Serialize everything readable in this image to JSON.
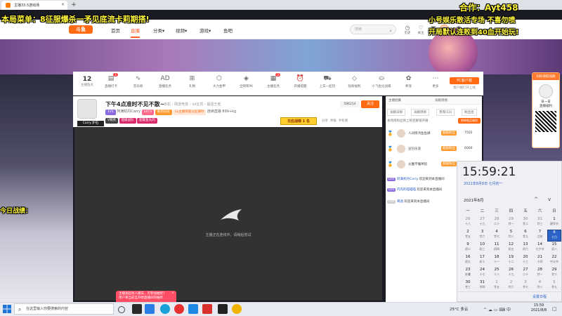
{
  "browser": {
    "tab_title": "主播33.5游戏场",
    "new_tab": "+"
  },
  "site": {
    "logo": "斗鱼",
    "nav": [
      "首页",
      "直播",
      "分类",
      "视频",
      "游戏",
      "鱼吧"
    ],
    "nav_arrows": [
      "▾",
      "▾",
      "▾"
    ],
    "search_placeholder": "搜索",
    "header_icons": [
      {
        "icon": "clock-icon",
        "label": "历史"
      },
      {
        "icon": "follow-icon",
        "label": "关注"
      },
      {
        "icon": "video-icon",
        "label": "视频"
      },
      {
        "icon": "broadcast-icon",
        "label": "开播"
      }
    ]
  },
  "toolbar": {
    "count": "12",
    "count_label": "主播鱼丸",
    "items": [
      {
        "icon": "bag-icon",
        "label": "直播打卡",
        "badge": "1"
      },
      {
        "icon": "waveform-icon",
        "label": "音乐榜"
      },
      {
        "icon": "ad-icon",
        "label": "直播任务"
      },
      {
        "icon": "gift-icon",
        "label": "礼物"
      },
      {
        "icon": "shield-icon",
        "label": "大力金甲"
      },
      {
        "icon": "shield2-icon",
        "label": "全网荣PK"
      },
      {
        "icon": "task-icon",
        "label": "主播任务",
        "badge": "2"
      },
      {
        "icon": "alarm-icon",
        "label": "开播提醒"
      },
      {
        "icon": "car-icon",
        "label": "上车一起玩"
      },
      {
        "icon": "diamond-icon",
        "label": "钻粉福利"
      },
      {
        "icon": "game-icon",
        "label": "小飞鱼论战棋"
      },
      {
        "icon": "pet-icon",
        "label": "养宠"
      },
      {
        "icon": "more-icon",
        "label": "更多"
      }
    ],
    "pc_button": "PC客户端",
    "pc_sub": "客户端打开上线"
  },
  "stream": {
    "title": "下午4点准时不见不散~",
    "category": "单机 › 网游竞技 › lol云顶 › 最强王者",
    "streamer_tag": "Carry 炉石",
    "meta": [
      "1V1",
      "阿满机丹Carry",
      "1473",
      "黄玥日玩",
      "LL主播荣誉认证满时",
      "连续直播",
      "899+kg"
    ],
    "viewers": "586214",
    "follow": "关注",
    "tags": [
      "V精英",
      "超级战队",
      "超能鱼丸的"
    ],
    "rank_btn": "日应战榜 1 名",
    "actions": [
      "分享",
      "举报",
      "手机看"
    ],
    "offline_text": "主播正在连线中，请稍后尝试",
    "toast": [
      "主播发起杀人跟车，可参加抽奖?",
      "用户将当前互开始直播间的抽奖"
    ],
    "toast_close": "×"
  },
  "right_panel": {
    "tabs": [
      "主播招募",
      "贡献周榜"
    ],
    "tabs2": [
      "贡献日榜",
      "贡献周榜",
      "贵宾(53)",
      "粉丝团"
    ],
    "note": "本场周粉丝榜上榜且解锁开播",
    "note_btn": "榜单购买福利",
    "ranks": [
      {
        "medal": "🏅",
        "name": "人间惊鸿鱼鱼肆",
        "level": "超级粉丝",
        "score": "7502"
      },
      {
        "medal": "🏅",
        "name": "豆包乐浪",
        "level": "超级粉丝",
        "score": "6000"
      },
      {
        "medal": "🏅",
        "name": "炎魔不懂神韵",
        "level": "超级粉丝",
        "score": "4"
      }
    ],
    "chats": [
      {
        "tag": "LV4",
        "name": "阿满机丹Carry",
        "text": "欢迎来到本直播间"
      },
      {
        "tag": "LV4",
        "name": "内内的喵喵喵",
        "text": "欢迎来到本直播间"
      },
      {
        "tag": "LV4",
        "name": "喝酒",
        "text": "欢迎来到本直播间"
      }
    ]
  },
  "overlays": {
    "top_left": "本局菜单：8征服爆杀一矛见底流卡莉期搭!",
    "top_right": "合作：Ayt458",
    "right_2": "小号娱乐散活专场 不喜勿喷",
    "right_3": "开局默认连败到40血开始玩!",
    "left_mid": "今日战绩："
  },
  "qr_card": {
    "header": "扫码领取加群",
    "name": "日一日",
    "sub": "直播福利"
  },
  "calendar": {
    "time": "15:59:21",
    "date_line": "2021年8月8日 七月初一",
    "month": "2021年8月",
    "nav_up": "^",
    "nav_down": "v",
    "weekdays": [
      "一",
      "二",
      "三",
      "四",
      "五",
      "六",
      "日"
    ],
    "days": [
      {
        "d": "26",
        "s": "十八",
        "dim": true
      },
      {
        "d": "27",
        "s": "十九",
        "dim": true
      },
      {
        "d": "28",
        "s": "二十",
        "dim": true
      },
      {
        "d": "29",
        "s": "廿一",
        "dim": true
      },
      {
        "d": "30",
        "s": "廿二",
        "dim": true
      },
      {
        "d": "31",
        "s": "廿三",
        "dim": true
      },
      {
        "d": "1",
        "s": "建军节"
      },
      {
        "d": "2",
        "s": "廿五"
      },
      {
        "d": "3",
        "s": "廿六"
      },
      {
        "d": "4",
        "s": "廿七"
      },
      {
        "d": "5",
        "s": "廿八"
      },
      {
        "d": "6",
        "s": "廿九"
      },
      {
        "d": "7",
        "s": "立秋"
      },
      {
        "d": "8",
        "s": "七月",
        "today": true
      },
      {
        "d": "9",
        "s": "初二"
      },
      {
        "d": "10",
        "s": "初三"
      },
      {
        "d": "11",
        "s": "初四"
      },
      {
        "d": "12",
        "s": "初五"
      },
      {
        "d": "13",
        "s": "初六"
      },
      {
        "d": "14",
        "s": "七夕节"
      },
      {
        "d": "15",
        "s": "初八"
      },
      {
        "d": "16",
        "s": "初九"
      },
      {
        "d": "17",
        "s": "初十"
      },
      {
        "d": "18",
        "s": "十一"
      },
      {
        "d": "19",
        "s": "十二"
      },
      {
        "d": "20",
        "s": "十三"
      },
      {
        "d": "21",
        "s": "十四"
      },
      {
        "d": "22",
        "s": "中元节"
      },
      {
        "d": "23",
        "s": "处暑"
      },
      {
        "d": "24",
        "s": "十七"
      },
      {
        "d": "25",
        "s": "十八"
      },
      {
        "d": "26",
        "s": "十九"
      },
      {
        "d": "27",
        "s": "二十"
      },
      {
        "d": "28",
        "s": "廿一"
      },
      {
        "d": "29",
        "s": "廿二"
      },
      {
        "d": "30",
        "s": "廿三"
      },
      {
        "d": "31",
        "s": "廿四"
      },
      {
        "d": "1",
        "s": "廿五",
        "dim": true
      },
      {
        "d": "2",
        "s": "廿六",
        "dim": true
      },
      {
        "d": "3",
        "s": "廿七",
        "dim": true
      },
      {
        "d": "4",
        "s": "廿八",
        "dim": true
      },
      {
        "d": "5",
        "s": "廿九",
        "dim": true
      }
    ],
    "settings": "设置日程"
  },
  "taskbar": {
    "search": "在这里输入你要搜索的内容",
    "weather": "25°C 多云",
    "tray": "^ ☁ ▭ ⌨ 中",
    "time": "15:59",
    "date": "2021/8/8"
  },
  "colors": {
    "accent": "#ff6a13",
    "overlay_text": "#fff63a",
    "today": "#2b63c6"
  }
}
